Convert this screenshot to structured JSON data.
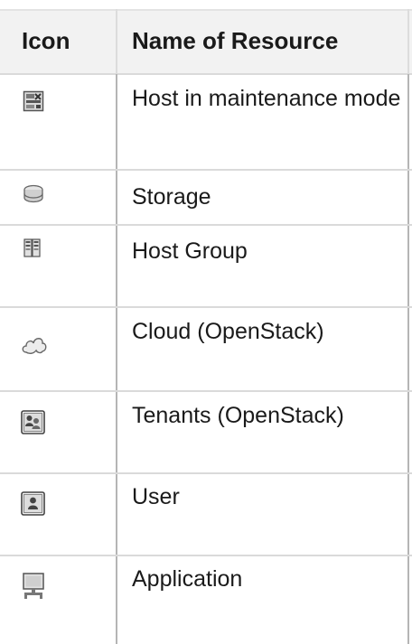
{
  "table": {
    "headers": {
      "icon": "Icon",
      "name": "Name of Resource"
    },
    "rows": [
      {
        "icon": "host-maintenance-icon",
        "name": "Host in maintenance mode"
      },
      {
        "icon": "storage-icon",
        "name": "Storage"
      },
      {
        "icon": "host-group-icon",
        "name": "Host Group"
      },
      {
        "icon": "cloud-icon",
        "name": "Cloud (OpenStack)"
      },
      {
        "icon": "tenants-icon",
        "name": "Tenants (OpenStack)"
      },
      {
        "icon": "user-icon",
        "name": "User"
      },
      {
        "icon": "application-icon",
        "name": "Application"
      }
    ]
  }
}
